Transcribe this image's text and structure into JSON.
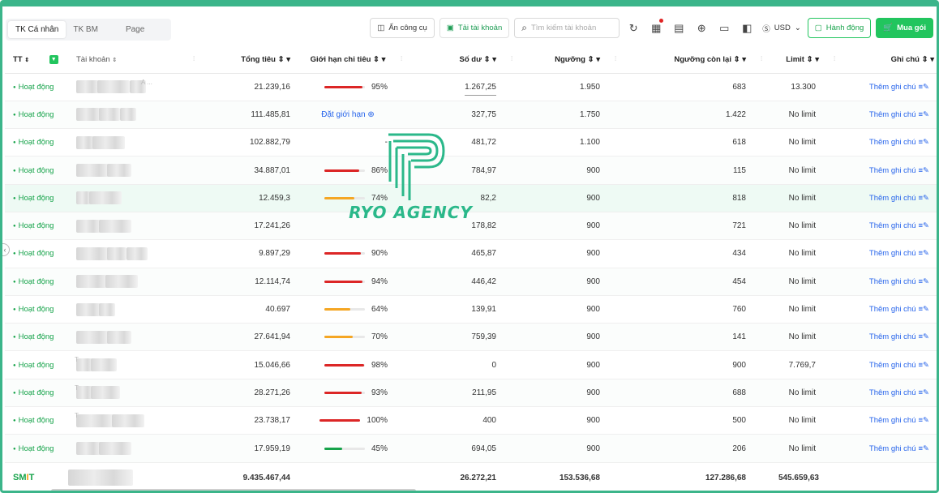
{
  "toolbar": {
    "tabs": [
      "TK Cá nhân",
      "TK BM",
      "Page"
    ],
    "hide_tools_label": "Ẩn công cụ",
    "download_label": "Tải tài khoản",
    "search_placeholder": "Tìm kiếm tài khoản",
    "currency_label": "USD",
    "action_label": "Hành động",
    "buy_label": "Mua gói"
  },
  "table": {
    "headers": {
      "status": "TT",
      "account": "Tài khoản",
      "total_spend": "Tổng tiêu",
      "spend_limit": "Giới hạn chi tiêu",
      "balance": "Số dư",
      "threshold": "Ngưỡng",
      "remaining_threshold": "Ngưỡng còn lại",
      "limit": "Limit",
      "note": "Ghi chú"
    },
    "rows": [
      {
        "status": "Hoạt động",
        "account": "A ...",
        "total": "21.239,16",
        "limit_pct": "95%",
        "limit_value": 0.95,
        "limit_color": "#dc2626",
        "balance": "1.267,25",
        "threshold": "1.950",
        "remaining": "683",
        "limit": "13.300",
        "note": "Thêm ghi chú"
      },
      {
        "status": "Hoạt động",
        "account": "",
        "total": "111.485,81",
        "limit_text": "Đặt giới hạn",
        "balance": "327,75",
        "threshold": "1.750",
        "remaining": "1.422",
        "limit": "No limit",
        "note": "Thêm ghi chú"
      },
      {
        "status": "Hoạt động",
        "account": "",
        "total": "102.882,79",
        "limit_text": "-",
        "balance": "481,72",
        "threshold": "1.100",
        "remaining": "618",
        "limit": "No limit",
        "note": "Thêm ghi chú"
      },
      {
        "status": "Hoạt động",
        "account": "",
        "total": "34.887,01",
        "limit_pct": "86%",
        "limit_value": 0.86,
        "limit_color": "#dc2626",
        "balance": "784,97",
        "threshold": "900",
        "remaining": "115",
        "limit": "No limit",
        "note": "Thêm ghi chú"
      },
      {
        "status": "Hoạt động",
        "account": "",
        "total": "12.459,3",
        "limit_pct": "74%",
        "limit_value": 0.74,
        "limit_color": "#f5a623",
        "balance": "82,2",
        "threshold": "900",
        "remaining": "818",
        "limit": "No limit",
        "note": "Thêm ghi chú"
      },
      {
        "status": "Hoạt động",
        "account": "",
        "total": "17.241,26",
        "limit_text": "",
        "balance": "178,82",
        "threshold": "900",
        "remaining": "721",
        "limit": "No limit",
        "note": "Thêm ghi chú"
      },
      {
        "status": "Hoạt động",
        "account": "",
        "total": "9.897,29",
        "limit_pct": "90%",
        "limit_value": 0.9,
        "limit_color": "#dc2626",
        "balance": "465,87",
        "threshold": "900",
        "remaining": "434",
        "limit": "No limit",
        "note": "Thêm ghi chú"
      },
      {
        "status": "Hoạt động",
        "account": "",
        "total": "12.114,74",
        "limit_pct": "94%",
        "limit_value": 0.94,
        "limit_color": "#dc2626",
        "balance": "446,42",
        "threshold": "900",
        "remaining": "454",
        "limit": "No limit",
        "note": "Thêm ghi chú"
      },
      {
        "status": "Hoạt động",
        "account": "",
        "total": "40.697",
        "limit_pct": "64%",
        "limit_value": 0.64,
        "limit_color": "#f5a623",
        "balance": "139,91",
        "threshold": "900",
        "remaining": "760",
        "limit": "No limit",
        "note": "Thêm ghi chú"
      },
      {
        "status": "Hoạt động",
        "account": "",
        "total": "27.641,94",
        "limit_pct": "70%",
        "limit_value": 0.7,
        "limit_color": "#f5a623",
        "balance": "759,39",
        "threshold": "900",
        "remaining": "141",
        "limit": "No limit",
        "note": "Thêm ghi chú"
      },
      {
        "status": "Hoạt động",
        "account": "T",
        "total": "15.046,66",
        "limit_pct": "98%",
        "limit_value": 0.98,
        "limit_color": "#dc2626",
        "balance": "0",
        "threshold": "900",
        "remaining": "900",
        "limit": "7.769,7",
        "note": "Thêm ghi chú"
      },
      {
        "status": "Hoạt động",
        "account": "T",
        "total": "28.271,26",
        "limit_pct": "93%",
        "limit_value": 0.93,
        "limit_color": "#dc2626",
        "balance": "211,95",
        "threshold": "900",
        "remaining": "688",
        "limit": "No limit",
        "note": "Thêm ghi chú"
      },
      {
        "status": "Hoạt động",
        "account": "T",
        "total": "23.738,17",
        "limit_pct": "100%",
        "limit_value": 1.0,
        "limit_color": "#dc2626",
        "balance": "400",
        "threshold": "900",
        "remaining": "500",
        "limit": "No limit",
        "note": "Thêm ghi chú"
      },
      {
        "status": "Hoạt động",
        "account": "",
        "total": "17.959,19",
        "limit_pct": "45%",
        "limit_value": 0.45,
        "limit_color": "#16a34a",
        "balance": "694,05",
        "threshold": "900",
        "remaining": "206",
        "limit": "No limit",
        "note": "Thêm ghi chú"
      }
    ],
    "footer": {
      "brand": "SMIT",
      "total": "9.435.467,44",
      "balance": "26.272,21",
      "threshold": "153.536,68",
      "remaining": "127.286,68",
      "limit": "545.659,63"
    }
  },
  "watermark": {
    "text": "RYO AGENCY",
    "color": "#2bb88a"
  },
  "colors": {
    "accent_green": "#22c55e",
    "status_green": "#16a34a",
    "link_blue": "#2563eb",
    "frame_green": "#3bb58a"
  }
}
